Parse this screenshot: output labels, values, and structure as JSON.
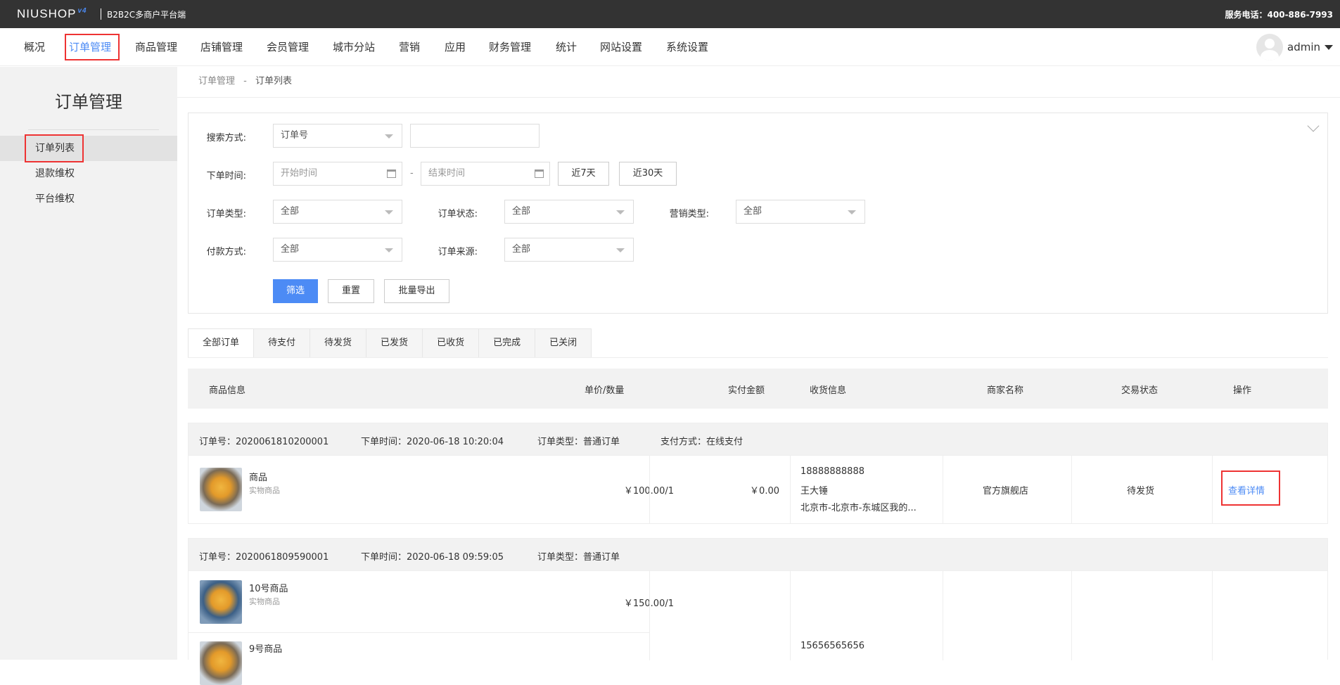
{
  "topbar": {
    "logo": "NIUSHOP",
    "logo_ver": "v4",
    "subtitle": "B2B2C多商户平台端",
    "phone": "服务电话：400-886-7993"
  },
  "nav": [
    "概况",
    "订单管理",
    "商品管理",
    "店铺管理",
    "会员管理",
    "城市分站",
    "营销",
    "应用",
    "财务管理",
    "统计",
    "网站设置",
    "系统设置"
  ],
  "user": {
    "name": "admin"
  },
  "sidebar": {
    "title": "订单管理",
    "items": [
      "订单列表",
      "退款维权",
      "平台维权"
    ]
  },
  "breadcrumb": {
    "parent": "订单管理",
    "sep": "-",
    "current": "订单列表"
  },
  "filter": {
    "search_label": "搜索方式:",
    "search_select": "订单号",
    "time_label": "下单时间:",
    "start_placeholder": "开始时间",
    "dash": "-",
    "end_placeholder": "结束时间",
    "btn_7": "近7天",
    "btn_30": "近30天",
    "type_label": "订单类型:",
    "type_value": "全部",
    "status_label": "订单状态:",
    "status_value": "全部",
    "promo_label": "营销类型:",
    "promo_value": "全部",
    "pay_label": "付款方式:",
    "pay_value": "全部",
    "source_label": "订单来源:",
    "source_value": "全部",
    "btn_filter": "筛选",
    "btn_reset": "重置",
    "btn_export": "批量导出"
  },
  "tabs": [
    "全部订单",
    "待支付",
    "待发货",
    "已发货",
    "已收货",
    "已完成",
    "已关闭"
  ],
  "table_head": {
    "goods": "商品信息",
    "price_qty": "单价/数量",
    "paid": "实付金额",
    "receiver": "收货信息",
    "shop": "商家名称",
    "status": "交易状态",
    "action": "操作"
  },
  "orders": [
    {
      "no": "订单号：2020061810200001",
      "time": "下单时间：2020-06-18 10:20:04",
      "type": "订单类型：普通订单",
      "pay": "支付方式：在线支付",
      "items": [
        {
          "name": "商品",
          "kind": "实物商品",
          "price": "￥100.00/1"
        }
      ],
      "paid": "￥0.00",
      "phone": "18888888888",
      "receiver": "王大锤",
      "address": "北京市-北京市-东城区我的...",
      "shop": "官方旗舰店",
      "status": "待发货",
      "action": "查看详情"
    },
    {
      "no": "订单号：2020061809590001",
      "time": "下单时间：2020-06-18 09:59:05",
      "type": "订单类型：普通订单",
      "items": [
        {
          "name": "10号商品",
          "kind": "实物商品",
          "price": "￥150.00/1"
        },
        {
          "name": "9号商品"
        }
      ],
      "phone": "15656565656"
    }
  ]
}
